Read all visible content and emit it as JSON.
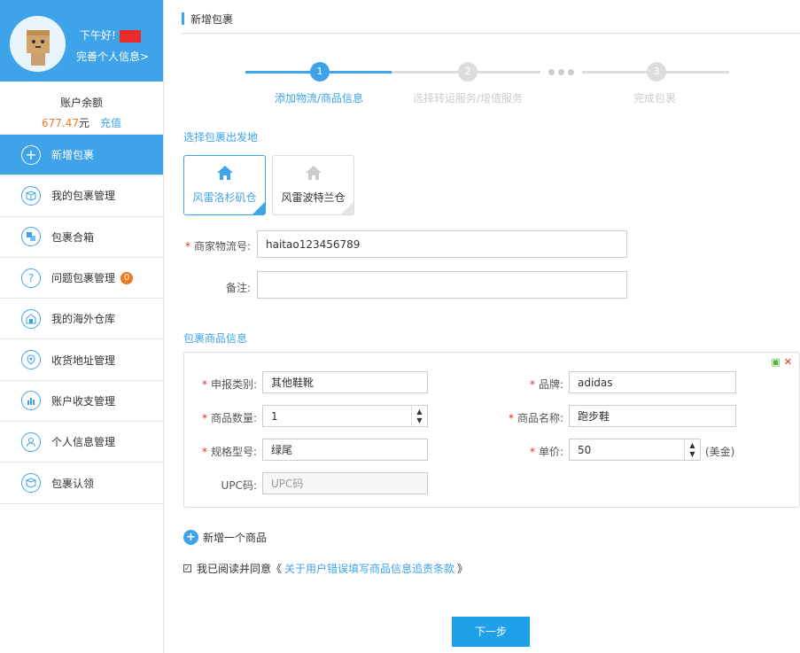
{
  "profile": {
    "greeting": "下午好!",
    "complete_link": "完善个人信息>"
  },
  "balance": {
    "label": "账户余额",
    "amount": "677.47",
    "unit": "元",
    "recharge": "充值"
  },
  "menu": [
    {
      "label": "新增包裹",
      "icon": "plus-circle-icon",
      "active": true
    },
    {
      "label": "我的包裹管理",
      "icon": "box-icon"
    },
    {
      "label": "包裹合箱",
      "icon": "merge-icon"
    },
    {
      "label": "问题包裹管理",
      "icon": "question-icon",
      "badge": "0"
    },
    {
      "label": "我的海外仓库",
      "icon": "warehouse-icon"
    },
    {
      "label": "收货地址管理",
      "icon": "location-icon"
    },
    {
      "label": "账户收支管理",
      "icon": "chart-icon"
    },
    {
      "label": "个人信息管理",
      "icon": "user-icon"
    },
    {
      "label": "包裹认领",
      "icon": "box-claim-icon"
    }
  ],
  "page": {
    "title": "新增包裹"
  },
  "steps": [
    {
      "num": "1",
      "label": "添加物流/商品信息"
    },
    {
      "num": "2",
      "label": "选择转运服务/增值服务"
    },
    {
      "num": "3",
      "label": "完成包裹"
    }
  ],
  "origin": {
    "title": "选择包裹出发地",
    "warehouses": [
      "风雷洛杉矶仓",
      "风雷波特兰仓"
    ]
  },
  "form": {
    "tracking_label": "商家物流号:",
    "tracking_value": "haitao123456789",
    "remark_label": "备注:",
    "remark_value": ""
  },
  "goods": {
    "title": "包裹商品信息",
    "category_label": "申报类别:",
    "category_value": "其他鞋靴",
    "brand_label": "品牌:",
    "brand_value": "adidas",
    "qty_label": "商品数量:",
    "qty_value": "1",
    "name_label": "商品名称:",
    "name_value": "跑步鞋",
    "spec_label": "规格型号:",
    "spec_value": "绿尾",
    "price_label": "单价:",
    "price_value": "50",
    "price_unit": "(美金)",
    "upc_label": "UPC码:",
    "upc_placeholder": "UPC码"
  },
  "add_item": "新增一个商品",
  "agree": {
    "prefix": "我已阅读并同意《",
    "link": "关于用户错误填写商品信息追责条款",
    "suffix": "》"
  },
  "next": "下一步",
  "colors": {
    "accent": "#3fa3ea",
    "required": "#e02b2b",
    "amount": "#f07a22"
  }
}
